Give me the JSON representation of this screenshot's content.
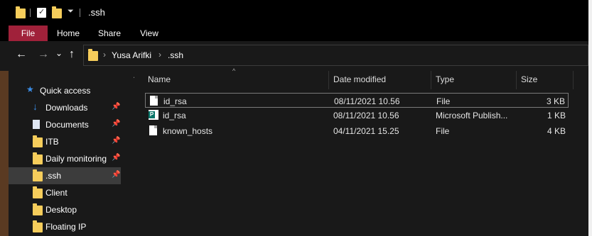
{
  "window": {
    "title": ".ssh"
  },
  "quick_access_toolbar": {
    "icons": [
      "folder-icon",
      "properties-icon",
      "new-folder-icon",
      "dropdown-icon"
    ]
  },
  "ribbon": {
    "tabs": [
      "File",
      "Home",
      "Share",
      "View"
    ]
  },
  "nav": {
    "back": "←",
    "forward": "→",
    "recent": "⌄",
    "up": "↑"
  },
  "address_bar": {
    "breadcrumb": [
      "Yusa Arifki",
      ".ssh"
    ],
    "separator": "›"
  },
  "sidebar": {
    "items": [
      {
        "label": "Quick access",
        "icon": "star-icon",
        "pinned": false,
        "selected": false
      },
      {
        "label": "Downloads",
        "icon": "download-arrow-icon",
        "pinned": true,
        "selected": false
      },
      {
        "label": "Documents",
        "icon": "documents-icon",
        "pinned": true,
        "selected": false
      },
      {
        "label": "ITB",
        "icon": "folder-icon",
        "pinned": true,
        "selected": false
      },
      {
        "label": "Daily monitoring",
        "icon": "folder-icon",
        "pinned": true,
        "selected": false
      },
      {
        "label": ".ssh",
        "icon": "folder-icon",
        "pinned": true,
        "selected": true
      },
      {
        "label": "Client",
        "icon": "folder-icon",
        "pinned": false,
        "selected": false
      },
      {
        "label": "Desktop",
        "icon": "folder-icon",
        "pinned": false,
        "selected": false
      },
      {
        "label": "Floating IP",
        "icon": "folder-icon",
        "pinned": false,
        "selected": false
      }
    ]
  },
  "file_list": {
    "columns": [
      "Name",
      "Date modified",
      "Type",
      "Size"
    ],
    "rows": [
      {
        "name": "id_rsa",
        "date": "08/11/2021 10.56",
        "type": "File",
        "size": "3 KB",
        "icon": "file-icon",
        "focused": true
      },
      {
        "name": "id_rsa",
        "date": "08/11/2021 10.56",
        "type": "Microsoft Publish...",
        "size": "1 KB",
        "icon": "publisher-icon",
        "focused": false
      },
      {
        "name": "known_hosts",
        "date": "04/11/2021 15.25",
        "type": "File",
        "size": "4 KB",
        "icon": "file-icon",
        "focused": false
      }
    ]
  },
  "colors": {
    "file_tab": "#a0213a",
    "folder": "#f6cd5b",
    "background": "#191919",
    "selected": "#3c3c3c"
  }
}
